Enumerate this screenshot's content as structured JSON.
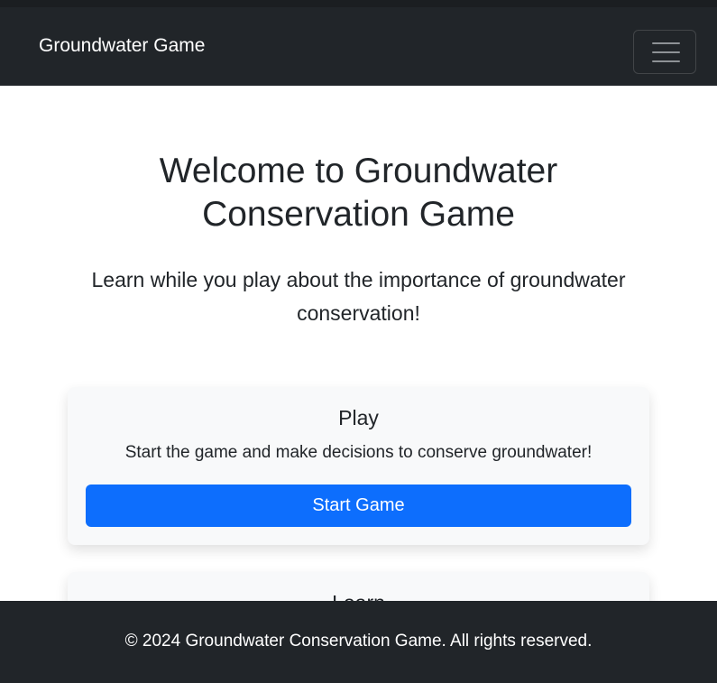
{
  "navbar": {
    "brand": "Groundwater Game",
    "toggler_icon": "hamburger-menu-icon"
  },
  "hero": {
    "title": "Welcome to Groundwater Conservation Game",
    "lead": "Learn while you play about the importance of groundwater conservation!"
  },
  "cards": [
    {
      "title": "Play",
      "text": "Start the game and make decisions to conserve groundwater!",
      "button_label": "Start Game"
    },
    {
      "title": "Learn"
    }
  ],
  "footer": {
    "text": "© 2024 Groundwater Conservation Game. All rights reserved."
  },
  "colors": {
    "navbar_bg": "#212529",
    "primary": "#0d6efd",
    "card_bg": "#f8f9fa",
    "footer_bg": "#212529"
  }
}
